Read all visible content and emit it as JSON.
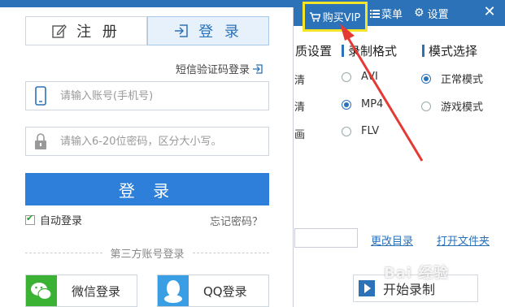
{
  "app": {
    "buy_vip": "购买VIP",
    "menu": "菜单",
    "settings": "设置",
    "close": "✕",
    "section_headers": {
      "quality": "质设置",
      "format": "录制格式",
      "mode": "模式选择"
    },
    "quality_partial": [
      "清",
      "清",
      "画"
    ],
    "format_options": [
      {
        "label": "AVI",
        "selected": false
      },
      {
        "label": "MP4",
        "selected": true
      },
      {
        "label": "FLV",
        "selected": false
      }
    ],
    "mode_options": [
      {
        "label": "正常模式",
        "selected": true
      },
      {
        "label": "游戏模式",
        "selected": false
      }
    ],
    "change_dir": "更改目录",
    "open_folder": "打开文件夹",
    "start_record": "开始录制",
    "watermark": "Bai 经验"
  },
  "login": {
    "tab_register": "注 册",
    "tab_login": "登 录",
    "sms_login": "短信验证码登录",
    "account_placeholder": "请输入账号(手机号)",
    "password_placeholder": "请输入6-20位密码，区分大小写。",
    "login_button": "登 录",
    "auto_login": "自动登录",
    "auto_login_checked": true,
    "forgot_password": "忘记密码？",
    "third_party": "第三方账号登录",
    "wechat_login": "微信登录",
    "qq_login": "QQ登录"
  },
  "colors": {
    "brand_blue": "#2b72b8",
    "button_blue": "#2d7fd9",
    "highlight_yellow": "#f4e529",
    "arrow_red": "#e53935",
    "wechat_green": "#3bb234",
    "qq_blue": "#3a9ee4"
  }
}
